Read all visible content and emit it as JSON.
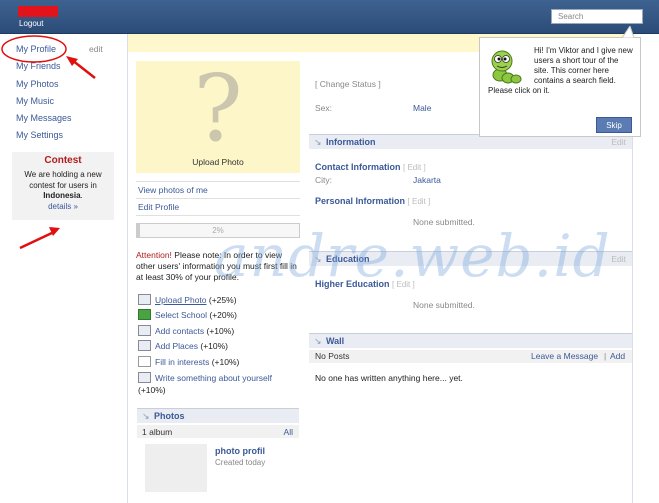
{
  "header": {
    "logout": "Logout",
    "search_placeholder": "Search"
  },
  "leftnav": {
    "items": [
      "My Profile",
      "My Friends",
      "My Photos",
      "My Music",
      "My Messages",
      "My Settings"
    ],
    "edit": "edit"
  },
  "contest": {
    "title": "Contest",
    "body_before": "We are holding a new contest for users in ",
    "country": "Indonesia",
    "body_after": ".",
    "link": "details »"
  },
  "profile": {
    "upload_photo": "Upload Photo",
    "view_photos": "View photos of me",
    "edit_profile": "Edit Profile",
    "completion": {
      "text": "2%",
      "value_percent": 2
    },
    "attention_label": "Attention!",
    "attention_text": " Please note: In order to view other users' information you must first fill in at least 30% of your profile.",
    "tasks": [
      {
        "label": "Upload Photo",
        "bonus": "(+25%)",
        "icon": "photo-icon"
      },
      {
        "label": "Select School",
        "bonus": "(+20%)",
        "icon": "plus-icon"
      },
      {
        "label": "Add contacts",
        "bonus": "(+10%)",
        "icon": "contacts-icon"
      },
      {
        "label": "Add Places",
        "bonus": "(+10%)",
        "icon": "places-icon"
      },
      {
        "label": "Fill in interests",
        "bonus": "(+10%)",
        "icon": "page-icon"
      },
      {
        "label": "Write something about yourself",
        "bonus": "(+10%)",
        "icon": "comment-icon"
      }
    ]
  },
  "photos": {
    "title": "Photos",
    "count": "1 album",
    "all": "All",
    "album_title": "photo profil",
    "album_meta": "Created today"
  },
  "main": {
    "change_status": "[ Change Status ]",
    "sex_label": "Sex:",
    "sex_value": "Male",
    "information": {
      "title": "Information",
      "edit": "Edit"
    },
    "contact": {
      "title": "Contact Information",
      "edit": "[ Edit ]",
      "city_label": "City:",
      "city_value": "Jakarta"
    },
    "personal": {
      "title": "Personal Information",
      "edit": "[ Edit ]",
      "empty": "None submitted."
    },
    "education": {
      "title": "Education",
      "edit": "Edit",
      "higher_title": "Higher Education",
      "higher_edit": "[ Edit ]",
      "empty": "None submitted."
    },
    "wall": {
      "title": "Wall",
      "no_posts": "No Posts",
      "leave": "Leave a Message",
      "separator": "|",
      "add": "Add",
      "empty": "No one has written anything here... yet."
    }
  },
  "tour": {
    "text": "Hi! I'm Viktor and I give new users a short tour of the site. This corner here contains a search field. Please click on it.",
    "skip": "Skip"
  },
  "watermark": "andre.web.id",
  "colors": {
    "header": "#3e6290",
    "link": "#3b5998",
    "highlight_yellow": "#fdf6c8",
    "annotation_red": "#e01010"
  }
}
